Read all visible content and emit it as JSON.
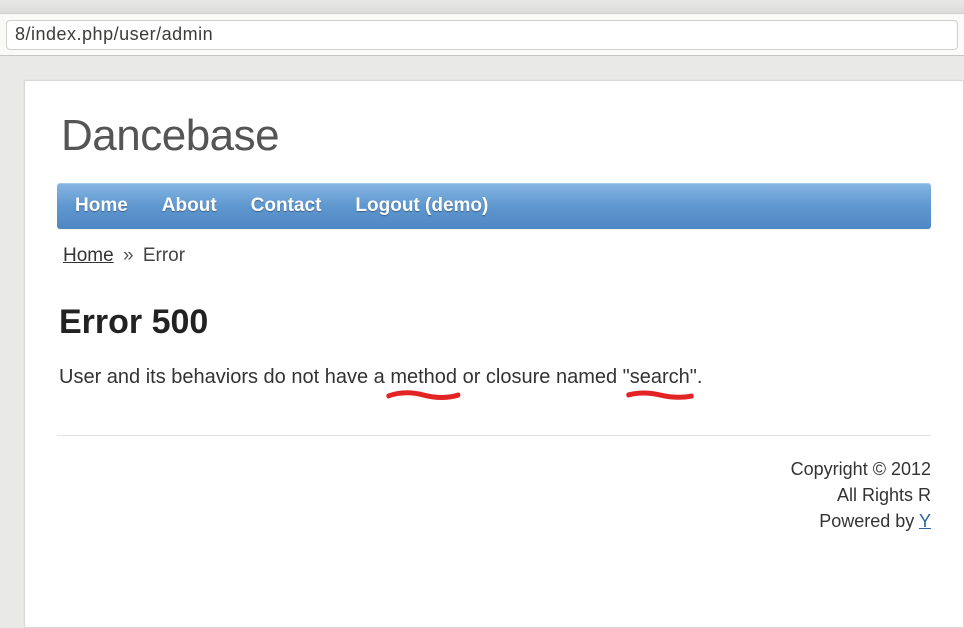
{
  "browser": {
    "url_visible": "8/index.php/user/admin"
  },
  "site": {
    "title": "Dancebase"
  },
  "nav": {
    "items": [
      "Home",
      "About",
      "Contact",
      "Logout (demo)"
    ]
  },
  "breadcrumb": {
    "home": "Home",
    "sep": "»",
    "current": "Error"
  },
  "error": {
    "heading": "Error 500",
    "msg_pre": "User and its behaviors do not have a ",
    "msg_underlined1": "method",
    "msg_mid": " or closure named \"",
    "msg_underlined2": "search",
    "msg_post": "\"."
  },
  "footer": {
    "copyright": "Copyright © 2012",
    "rights": "All Rights R",
    "powered_pre": "Powered by ",
    "powered_link": "Y"
  }
}
